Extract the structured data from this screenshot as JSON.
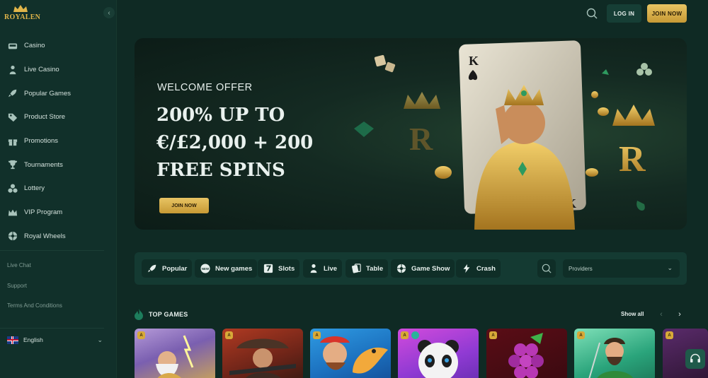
{
  "brand": {
    "name": "ROYALEN"
  },
  "sidebar": {
    "collapse_icon": "chevron-left-icon",
    "items": [
      {
        "label": "Casino",
        "icon": "casino-icon"
      },
      {
        "label": "Live Casino",
        "icon": "dealer-icon"
      },
      {
        "label": "Popular Games",
        "icon": "rocket-icon"
      },
      {
        "label": "Product Store",
        "icon": "tag-icon"
      },
      {
        "label": "Promotions",
        "icon": "gift-icon"
      },
      {
        "label": "Tournaments",
        "icon": "trophy-icon"
      },
      {
        "label": "Lottery",
        "icon": "lottery-icon"
      },
      {
        "label": "VIP Program",
        "icon": "crown-icon"
      },
      {
        "label": "Royal Wheels",
        "icon": "wheel-icon"
      }
    ],
    "links": [
      "Live Chat",
      "Support",
      "Terms And Conditions"
    ],
    "language": "English"
  },
  "header": {
    "login_label": "LOG IN",
    "join_label": "JOIN NOW"
  },
  "hero": {
    "label": "WELCOME OFFER",
    "title_lines": [
      "200% UP TO",
      "€/£2,000 + 200",
      "FREE SPINS"
    ],
    "button_label": "JOIN NOW"
  },
  "filters": {
    "chips": [
      {
        "label": "Popular",
        "icon": "rocket-icon"
      },
      {
        "label": "New games",
        "icon": "new-badge-icon"
      },
      {
        "label": "Slots",
        "icon": "slot-seven-icon"
      },
      {
        "label": "Live",
        "icon": "dealer-icon"
      },
      {
        "label": "Table",
        "icon": "cards-icon"
      },
      {
        "label": "Game Show",
        "icon": "wheel-icon"
      },
      {
        "label": "Crash",
        "icon": "lightning-icon"
      }
    ],
    "providers_placeholder": "Providers"
  },
  "top_games": {
    "title": "TOP GAMES",
    "show_all": "Show all"
  },
  "colors": {
    "accent_gold": "#d7a938",
    "bg": "#0f2a24",
    "panel": "#143a32"
  }
}
